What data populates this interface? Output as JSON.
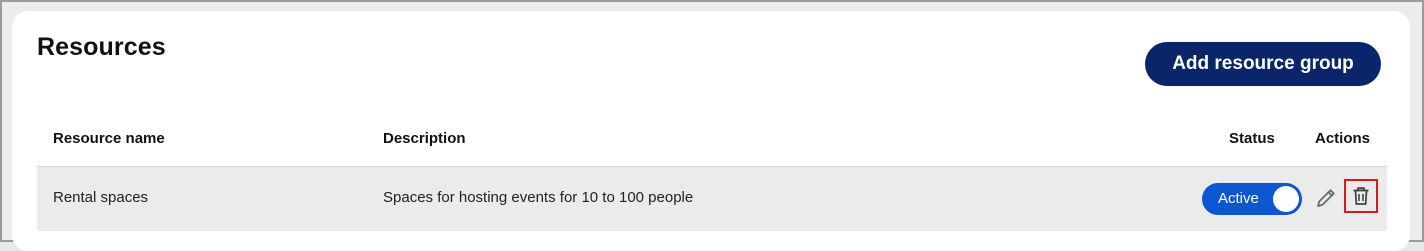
{
  "page": {
    "title": "Resources",
    "add_button_label": "Add resource group"
  },
  "table": {
    "columns": {
      "name": "Resource name",
      "description": "Description",
      "status": "Status",
      "actions": "Actions"
    },
    "rows": [
      {
        "name": "Rental spaces",
        "description": "Spaces for hosting events for 10 to 100 people",
        "status_label": "Active",
        "status_on": true,
        "edit_icon": "pencil-icon",
        "delete_icon": "trash-icon"
      }
    ]
  },
  "colors": {
    "primary_button": "#0a2569",
    "toggle_active": "#0b57d0",
    "highlight_border": "#d81b1b",
    "row_background": "#ebebeb"
  }
}
